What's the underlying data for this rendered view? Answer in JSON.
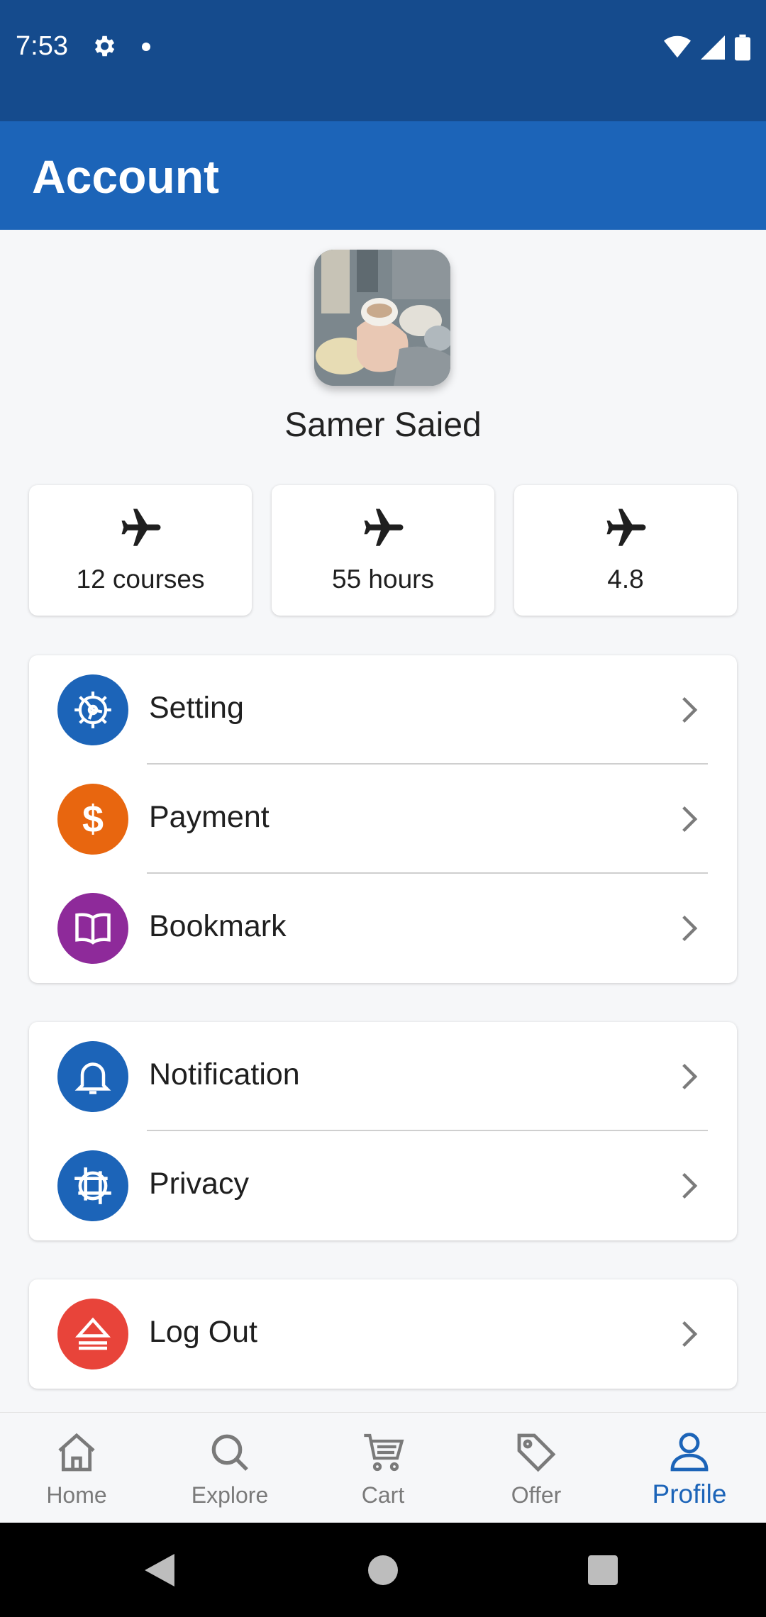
{
  "status_bar": {
    "time": "7:53"
  },
  "app_bar": {
    "title": "Account"
  },
  "profile": {
    "name": "Samer Saied"
  },
  "stats": [
    {
      "label": "12 courses",
      "icon": "airplane-icon"
    },
    {
      "label": "55 hours",
      "icon": "airplane-icon"
    },
    {
      "label": "4.8",
      "icon": "airplane-icon"
    }
  ],
  "menu_group_1": [
    {
      "label": "Setting",
      "icon": "settings-icon",
      "color": "#1c64b8"
    },
    {
      "label": "Payment",
      "icon": "dollar-icon",
      "color": "#e8660f"
    },
    {
      "label": "Bookmark",
      "icon": "book-icon",
      "color": "#8e2a9a"
    }
  ],
  "menu_group_2": [
    {
      "label": "Notification",
      "icon": "bell-icon",
      "color": "#1c64b8"
    },
    {
      "label": "Privacy",
      "icon": "privacy-icon",
      "color": "#1c64b8"
    }
  ],
  "menu_group_3": [
    {
      "label": "Log Out",
      "icon": "eject-icon",
      "color": "#e8443a"
    }
  ],
  "bottom_nav": [
    {
      "label": "Home",
      "icon": "home-icon",
      "active": false
    },
    {
      "label": "Explore",
      "icon": "search-icon",
      "active": false
    },
    {
      "label": "Cart",
      "icon": "cart-icon",
      "active": false
    },
    {
      "label": "Offer",
      "icon": "tag-icon",
      "active": false
    },
    {
      "label": "Profile",
      "icon": "person-icon",
      "active": true
    }
  ],
  "colors": {
    "status_bar": "#154b8d",
    "app_bar": "#1c64b8",
    "accent": "#1c64b8"
  }
}
